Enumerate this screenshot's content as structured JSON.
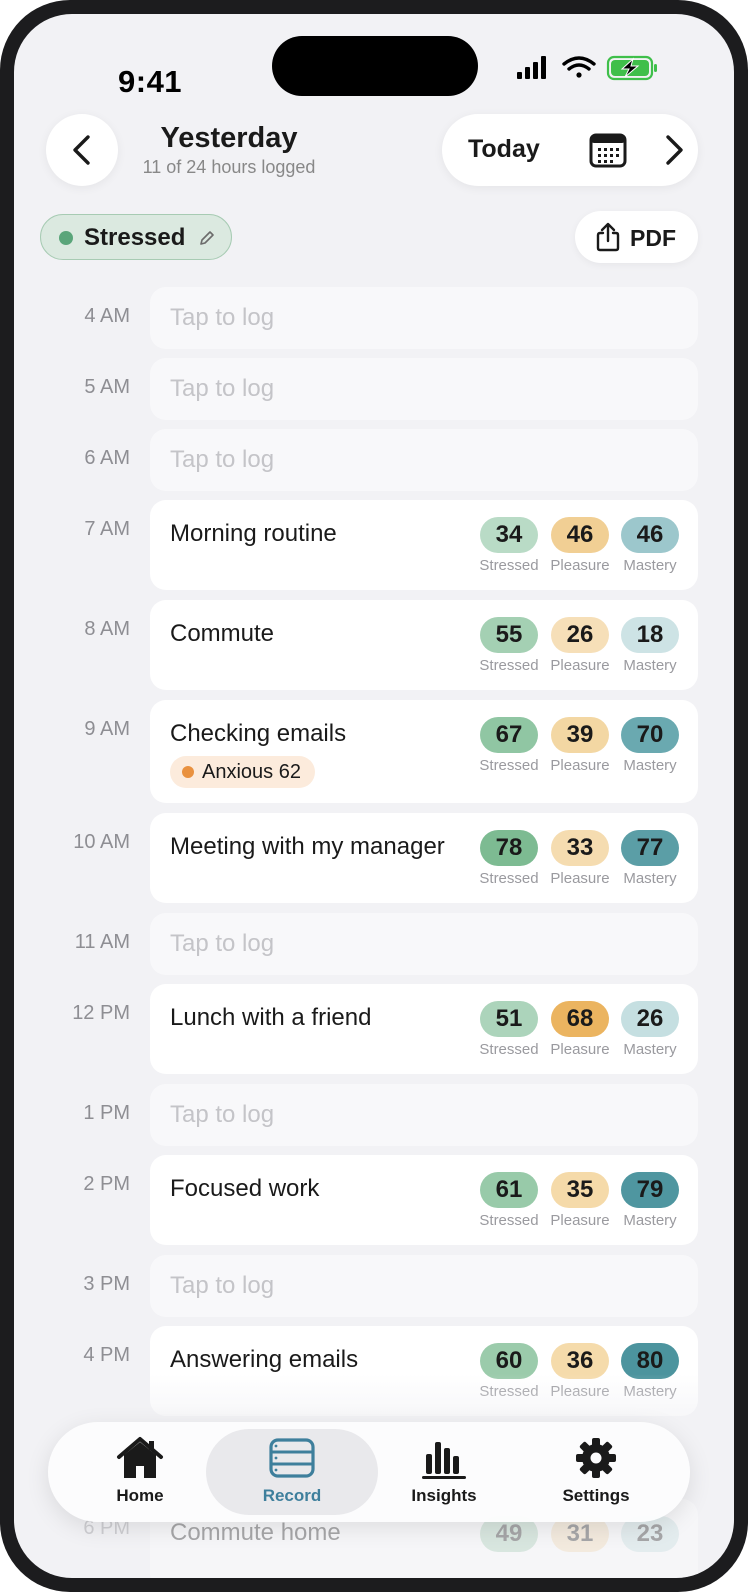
{
  "status_bar": {
    "time": "9:41"
  },
  "header": {
    "back_icon": "chevron-left-icon",
    "title": "Yesterday",
    "subtitle": "11 of 24 hours logged",
    "today_label": "Today",
    "calendar_icon": "calendar-icon",
    "forward_icon": "chevron-right-icon"
  },
  "mood_chip": {
    "label": "Stressed",
    "dot_color": "#5aa57a",
    "edit_icon": "pencil-icon"
  },
  "pdf_button": {
    "label": "PDF",
    "icon": "share-icon"
  },
  "score_labels": {
    "stressed": "Stressed",
    "pleasure": "Pleasure",
    "mastery": "Mastery"
  },
  "empty_placeholder": "Tap to log",
  "rows": [
    {
      "hour": "4 AM",
      "logged": false
    },
    {
      "hour": "5 AM",
      "logged": false
    },
    {
      "hour": "6 AM",
      "logged": false
    },
    {
      "hour": "7 AM",
      "logged": true,
      "activity": "Morning routine",
      "stressed": "34",
      "pleasure": "46",
      "mastery": "46"
    },
    {
      "hour": "8 AM",
      "logged": true,
      "activity": "Commute",
      "stressed": "55",
      "pleasure": "26",
      "mastery": "18"
    },
    {
      "hour": "9 AM",
      "logged": true,
      "activity": "Checking emails",
      "stressed": "67",
      "pleasure": "39",
      "mastery": "70",
      "tag": "Anxious 62"
    },
    {
      "hour": "10 AM",
      "logged": true,
      "activity": "Meeting with my manager",
      "stressed": "78",
      "pleasure": "33",
      "mastery": "77"
    },
    {
      "hour": "11 AM",
      "logged": false
    },
    {
      "hour": "12 PM",
      "logged": true,
      "activity": "Lunch with a friend",
      "stressed": "51",
      "pleasure": "68",
      "mastery": "26"
    },
    {
      "hour": "1 PM",
      "logged": false
    },
    {
      "hour": "2 PM",
      "logged": true,
      "activity": "Focused work",
      "stressed": "61",
      "pleasure": "35",
      "mastery": "79"
    },
    {
      "hour": "3 PM",
      "logged": false
    },
    {
      "hour": "4 PM",
      "logged": true,
      "activity": "Answering emails",
      "stressed": "60",
      "pleasure": "36",
      "mastery": "80"
    },
    {
      "hour": "6 PM",
      "logged": true,
      "activity": "Commute home",
      "stressed": "49",
      "pleasure": "31",
      "mastery": "23"
    }
  ],
  "tab_bar": {
    "tabs": [
      {
        "label": "Home",
        "icon": "house-icon"
      },
      {
        "label": "Record",
        "icon": "record-list-icon",
        "active": true
      },
      {
        "label": "Insights",
        "icon": "bar-chart-icon"
      },
      {
        "label": "Settings",
        "icon": "gear-icon"
      }
    ],
    "active_color": "#3e7f9c"
  },
  "colors": {
    "stressed_base": "#5aa57a",
    "pleasure_base": "#e8a74a",
    "mastery_base": "#3f8d98"
  }
}
